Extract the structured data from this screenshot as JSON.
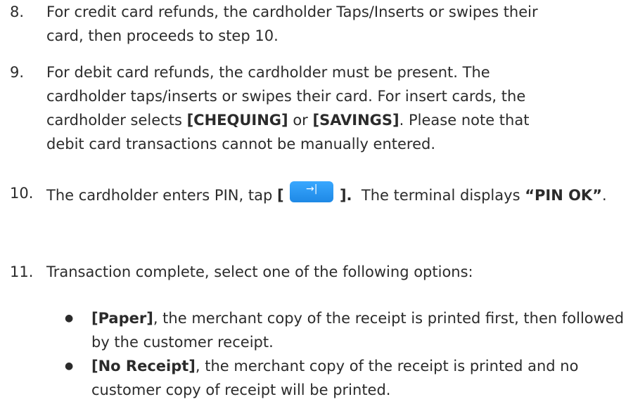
{
  "steps": [
    {
      "number": "8.",
      "lines": [
        "For credit card refunds, the cardholder Taps/Inserts or swipes their",
        "card, then proceeds to step 10."
      ]
    },
    {
      "number": "9.",
      "line1": "For debit card refunds, the cardholder must be present. The",
      "line2": "cardholder taps/inserts or swipes their card. For insert cards, the",
      "line3_pre": "cardholder selects ",
      "chequing": "[CHEQUING]",
      "or": " or ",
      "savings": "[SAVINGS]",
      "line3_post": ". Please note that",
      "line4": "debit card transactions cannot be manually entered."
    },
    {
      "number": "10.",
      "pre": "The cardholder enters PIN, tap ",
      "bracket_open": "[",
      "button_glyph": "→|",
      "button_icon": "enter-arrow-icon",
      "bracket_close": "].",
      "mid": "  The terminal displays ",
      "pin_ok": "“PIN OK”",
      "end": "."
    },
    {
      "number": "11.",
      "text": "Transaction complete, select one of the following options:"
    }
  ],
  "options": [
    {
      "bullet": "●",
      "label": "[Paper]",
      "text": ", the merchant copy of the receipt is printed first, then followed by the customer receipt."
    },
    {
      "bullet": "●",
      "label": "[No Receipt]",
      "text": ", the merchant copy of the receipt is printed and no customer copy of receipt will be printed."
    }
  ],
  "colors": {
    "text": "#2b2b2b",
    "button": "#2196f3",
    "background": "#ffffff"
  }
}
